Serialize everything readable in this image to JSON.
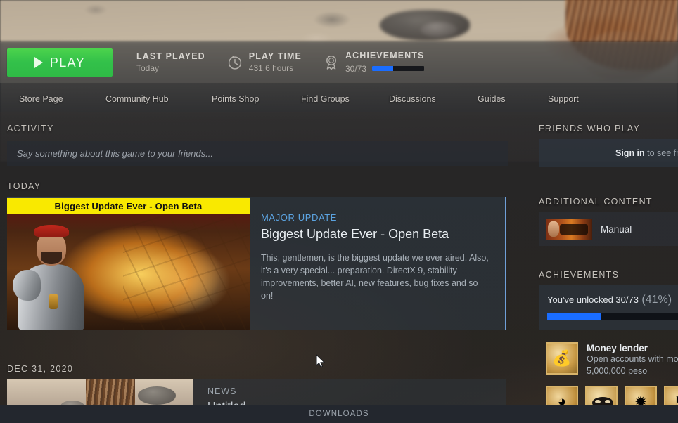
{
  "colors": {
    "play_green": "#33c14a",
    "progress_blue": "#1a6dff",
    "kicker_blue": "#5ba3e0",
    "card_border": "#6f9fd8",
    "banner_yellow": "#f9e900"
  },
  "actionbar": {
    "play_label": "PLAY",
    "stats": [
      {
        "name": "last-played",
        "heading": "LAST PLAYED",
        "value": "Today",
        "icon": "none"
      },
      {
        "name": "play-time",
        "heading": "PLAY TIME",
        "value": "431.6 hours",
        "icon": "clock-icon"
      },
      {
        "name": "achievements",
        "heading": "ACHIEVEMENTS",
        "value": "30/73",
        "icon": "trophy-ribbon-icon",
        "progress_percent": 41
      }
    ]
  },
  "nav": {
    "tabs": [
      {
        "label": "Store Page"
      },
      {
        "label": "Community Hub"
      },
      {
        "label": "Points Shop"
      },
      {
        "label": "Find Groups"
      },
      {
        "label": "Discussions"
      },
      {
        "label": "Guides"
      },
      {
        "label": "Support"
      }
    ]
  },
  "activity": {
    "heading": "ACTIVITY",
    "composer_placeholder": "Say something about this game to your friends...",
    "groups": [
      {
        "day": "TODAY",
        "post": {
          "banner_text": "Biggest Update Ever - Open Beta",
          "kicker": "MAJOR UPDATE",
          "title": "Biggest Update Ever - Open Beta",
          "description": "This, gentlemen, is the biggest update we ever aired. Also, it's a very special... preparation. DirectX 9, stability improvements, better AI, new features, bug fixes and so on!"
        }
      },
      {
        "day": "DEC 31, 2020",
        "post": {
          "kicker": "NEWS",
          "title": "Untitled"
        }
      }
    ]
  },
  "sidebar": {
    "friends": {
      "heading": "FRIENDS WHO PLAY",
      "signin_link": "Sign in",
      "signin_rest": " to see frien"
    },
    "additional_content": {
      "heading": "ADDITIONAL CONTENT",
      "items": [
        {
          "label": "Manual"
        }
      ]
    },
    "achievements": {
      "heading": "ACHIEVEMENTS",
      "unlocked_text": "You've unlocked 30/73",
      "percent_text": "(41%)",
      "progress_percent": 41,
      "featured": {
        "name": "Money lender",
        "description_line1": "Open accounts with mon",
        "description_line2": "5,000,000 peso",
        "icon": "money-bag-icon"
      },
      "grid": [
        {
          "icon": "gold-coins-icon",
          "glyph": "◕"
        },
        {
          "icon": "mask-icon",
          "glyph": ""
        },
        {
          "icon": "compass-icon",
          "glyph": "✹"
        },
        {
          "icon": "shield-crest-icon",
          "glyph": "⚑"
        }
      ]
    }
  },
  "downloads_bar": {
    "label": "DOWNLOADS"
  }
}
